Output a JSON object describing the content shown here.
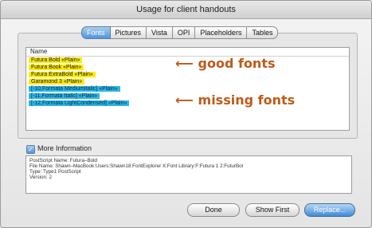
{
  "window": {
    "title": "Usage for client handouts"
  },
  "tabs": [
    {
      "label": "Fonts",
      "active": true
    },
    {
      "label": "Pictures",
      "active": false
    },
    {
      "label": "Vista",
      "active": false
    },
    {
      "label": "OPI",
      "active": false
    },
    {
      "label": "Placeholders",
      "active": false
    },
    {
      "label": "Tables",
      "active": false
    }
  ],
  "fonts_list": {
    "header": "Name",
    "rows": [
      {
        "name": "Futura Bold «Plain»",
        "status": "good"
      },
      {
        "name": "Futura Book «Plain»",
        "status": "good"
      },
      {
        "name": "Futura ExtraBold «Plain»",
        "status": "good"
      },
      {
        "name": "Garamond 3 «Plain»",
        "status": "good"
      },
      {
        "name": "[-10,Formata MediumItalic] «Plain»",
        "status": "missing"
      },
      {
        "name": "[-11,Formata Italic] «Plain»",
        "status": "missing"
      },
      {
        "name": "[-12,Formata LightCondensed] «Plain»",
        "status": "missing"
      }
    ]
  },
  "annotations": {
    "good": {
      "arrow": "⟵",
      "text": "good fonts"
    },
    "missing": {
      "arrow": "⟵",
      "text": "missing fonts"
    }
  },
  "more_info": {
    "checked": true,
    "label": "More Information",
    "lines": [
      "PostScript Name:  Futura–Bold",
      "File Name:  Shawn–MacBook:Users:Shawn18:FontExplorer X:Font Library:F:Futura 1 2:FuturBol",
      "Type: Type1 PostScript",
      "Version:  2"
    ]
  },
  "buttons": {
    "done": "Done",
    "show_first": "Show First",
    "replace": "Replace..."
  },
  "colors": {
    "good_highlight": "#ffec00",
    "missing_highlight": "#2ab6ea",
    "annotation": "#c05a18"
  },
  "icons": {
    "checkbox": "checkmark-icon",
    "arrow": "left-arrow-icon"
  }
}
